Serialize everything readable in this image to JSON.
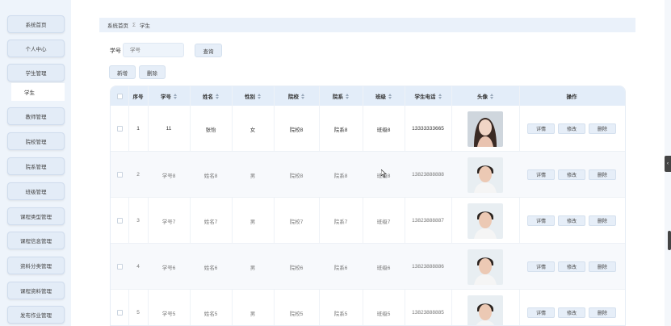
{
  "sidebar": {
    "items": [
      {
        "label": "系统首页"
      },
      {
        "label": "个人中心"
      },
      {
        "label": "学生管理"
      },
      {
        "label": "教师管理"
      },
      {
        "label": "院校管理"
      },
      {
        "label": "院系管理"
      },
      {
        "label": "班级管理"
      },
      {
        "label": "课程类型管理"
      },
      {
        "label": "课程信息管理"
      },
      {
        "label": "资料分类管理"
      },
      {
        "label": "课程资料管理"
      },
      {
        "label": "发布作业管理"
      }
    ],
    "sub_item": "学生"
  },
  "breadcrumb": {
    "home": "系统首页",
    "sep": "Σ",
    "current": "学生"
  },
  "search": {
    "label": "学号",
    "placeholder": "学号",
    "query_btn": "查询"
  },
  "toolbar": {
    "add": "新增",
    "delete": "删除"
  },
  "table": {
    "headers": [
      "序号",
      "学号",
      "姓名",
      "性别",
      "院校",
      "院系",
      "班级",
      "学生电话",
      "头像",
      "操作"
    ],
    "rows": [
      {
        "no": "1",
        "id": "11",
        "name": "张怡",
        "gender": "女",
        "school": "院校8",
        "dept": "院系8",
        "cls": "班级8",
        "phone": "13333333665",
        "avatar": "portrait-woman"
      },
      {
        "no": "2",
        "id": "学号8",
        "name": "姓名8",
        "gender": "男",
        "school": "院校8",
        "dept": "院系8",
        "cls": "班级8",
        "phone": "13823888888",
        "avatar": "portrait-man"
      },
      {
        "no": "3",
        "id": "学号7",
        "name": "姓名7",
        "gender": "男",
        "school": "院校7",
        "dept": "院系7",
        "cls": "班级7",
        "phone": "13823888887",
        "avatar": "portrait-man"
      },
      {
        "no": "4",
        "id": "学号6",
        "name": "姓名6",
        "gender": "男",
        "school": "院校6",
        "dept": "院系6",
        "cls": "班级6",
        "phone": "13823888886",
        "avatar": "portrait-man"
      },
      {
        "no": "5",
        "id": "学号5",
        "name": "姓名5",
        "gender": "男",
        "school": "院校5",
        "dept": "院系5",
        "cls": "班级5",
        "phone": "13823888885",
        "avatar": "portrait-man"
      }
    ],
    "actions": [
      "详情",
      "修改",
      "删除"
    ]
  },
  "colors": {
    "accent": "#e3edf9",
    "sidebar": "#eef4fb"
  }
}
